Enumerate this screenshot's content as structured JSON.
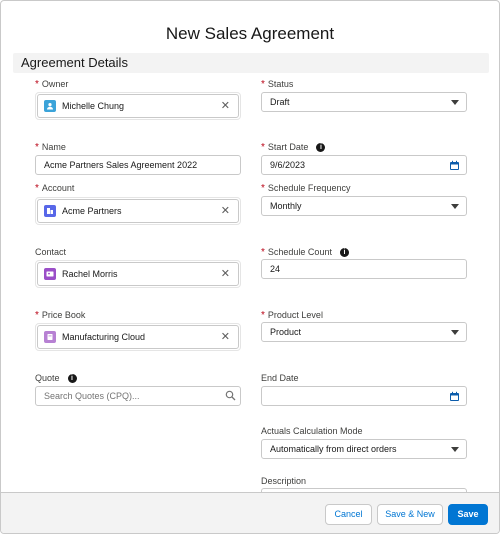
{
  "modal": {
    "title": "New Sales Agreement"
  },
  "section": {
    "title": "Agreement Details"
  },
  "fields": {
    "owner": {
      "label": "Owner",
      "value": "Michelle Chung",
      "icon": "user-icon",
      "icon_color": "#3ba3d9"
    },
    "name": {
      "label": "Name",
      "value": "Acme Partners Sales Agreement 2022"
    },
    "account": {
      "label": "Account",
      "value": "Acme Partners",
      "icon": "account-icon",
      "icon_color": "#5867e8"
    },
    "contact": {
      "label": "Contact",
      "value": "Rachel Morris",
      "icon": "contact-icon",
      "icon_color": "#9b4fc8"
    },
    "price_book": {
      "label": "Price Book",
      "value": "Manufacturing Cloud",
      "icon": "pricebook-icon",
      "icon_color": "#b781d3"
    },
    "quote": {
      "label": "Quote",
      "placeholder": "Search Quotes (CPQ)..."
    },
    "status": {
      "label": "Status",
      "value": "Draft"
    },
    "start_date": {
      "label": "Start Date",
      "value": "9/6/2023"
    },
    "schedule_frequency": {
      "label": "Schedule Frequency",
      "value": "Monthly"
    },
    "schedule_count": {
      "label": "Schedule Count",
      "value": "24"
    },
    "product_level": {
      "label": "Product Level",
      "value": "Product"
    },
    "end_date": {
      "label": "End Date",
      "value": ""
    },
    "actuals_mode": {
      "label": "Actuals Calculation Mode",
      "value": "Automatically from direct orders"
    },
    "description": {
      "label": "Description",
      "value": ""
    }
  },
  "footer": {
    "cancel": "Cancel",
    "save_new": "Save & New",
    "save": "Save"
  },
  "colors": {
    "brand": "#0176d3",
    "required": "#ba0517"
  }
}
